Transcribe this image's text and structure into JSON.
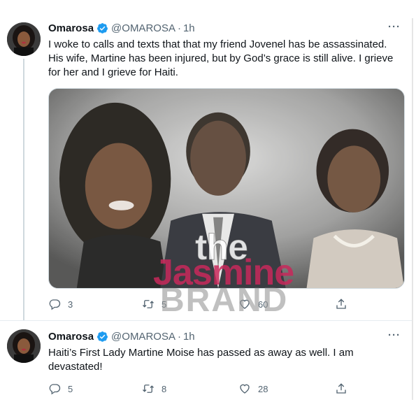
{
  "tweets": [
    {
      "author": "Omarosa",
      "handle": "@OMAROSA",
      "separator": "·",
      "time": "1h",
      "more": "···",
      "text": "I woke to calls and texts that that my friend Jovenel has be assassinated. His wife, Martine has been injured, but by God’s grace is still alive. I grieve for her and I grieve for Haiti.",
      "has_media": true,
      "replies": "3",
      "retweets": "5",
      "likes": "60"
    },
    {
      "author": "Omarosa",
      "handle": "@OMAROSA",
      "separator": "·",
      "time": "1h",
      "more": "···",
      "text": "Haiti’s First Lady Martine Moise has passed as away as well. I am devastated!",
      "has_media": false,
      "replies": "5",
      "retweets": "8",
      "likes": "28"
    }
  ],
  "watermark": {
    "line1": "the",
    "line2": "Jasmine",
    "line3": "BRAND"
  },
  "icons": {
    "verified": "verified-badge-icon",
    "reply": "reply-icon",
    "retweet": "retweet-icon",
    "like": "heart-icon",
    "share": "share-icon",
    "more": "more-icon"
  },
  "colors": {
    "verified": "#1d9bf0",
    "secondary_text": "#536471",
    "watermark_pink": "#c8285a"
  }
}
